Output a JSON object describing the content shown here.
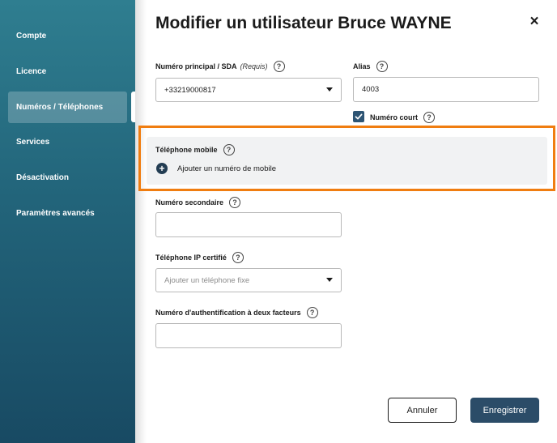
{
  "sidebar": {
    "items": [
      {
        "label": "Compte",
        "active": false
      },
      {
        "label": "Licence",
        "active": false
      },
      {
        "label": "Numéros / Téléphones",
        "active": true
      },
      {
        "label": "Services",
        "active": false
      },
      {
        "label": "Désactivation",
        "active": false
      },
      {
        "label": "Paramètres avancés",
        "active": false
      }
    ]
  },
  "header": {
    "title": "Modifier un utilisateur Bruce WAYNE",
    "close_icon": "×"
  },
  "form": {
    "principal": {
      "label": "Numéro principal / SDA",
      "required_note": "(Requis)",
      "value": "+33219000817"
    },
    "alias": {
      "label": "Alias",
      "value": "4003"
    },
    "short_number": {
      "label": "Numéro court",
      "checked": true
    },
    "mobile": {
      "label": "Téléphone mobile",
      "add_label": "Ajouter un numéro de mobile"
    },
    "secondary": {
      "label": "Numéro secondaire",
      "value": ""
    },
    "ip_phone": {
      "label": "Téléphone IP certifié",
      "placeholder": "Ajouter un téléphone fixe"
    },
    "two_factor": {
      "label": "Numéro d'authentification à deux facteurs",
      "value": ""
    },
    "help_glyph": "?"
  },
  "actions": {
    "cancel_label": "Annuler",
    "save_label": "Enregistrer"
  },
  "colors": {
    "highlight": "#f07d10",
    "primary": "#2b4c68",
    "sidebar_top": "#2f7e90",
    "sidebar_bottom": "#184a63"
  }
}
